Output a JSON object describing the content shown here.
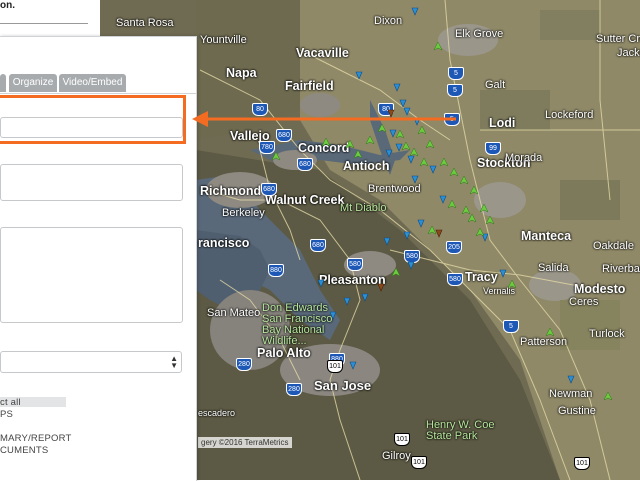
{
  "panel": {
    "top_text": "on.",
    "tabs": [
      {
        "label": ""
      },
      {
        "label": "Organize"
      },
      {
        "label": "Video/Embed"
      }
    ],
    "options": {
      "select_all": "ct all",
      "item_ps": "PS",
      "item_summary": "MARY/REPORT",
      "item_documents": "CUMENTS"
    }
  },
  "map": {
    "attribution": "gery ©2016 TerraMetrics",
    "labels": {
      "santa_rosa": "Santa Rosa",
      "dixon": "Dixon",
      "elk_grove": "Elk Grove",
      "sutter_creek": "Sutter Creek",
      "jackson": "Jackson",
      "yountville": "Yountville",
      "vacaville": "Vacaville",
      "napa": "Napa",
      "fairfield": "Fairfield",
      "galt": "Galt",
      "lodi": "Lodi",
      "lockeford": "Lockeford",
      "vallejo": "Vallejo",
      "concord": "Concord",
      "antioch": "Antioch",
      "brentwood": "Brentwood",
      "stockton": "Stockton",
      "morada": "Morada",
      "richmond": "Richmond",
      "walnut_creek": "Walnut Creek",
      "mt_diablo": "Mt Diablo",
      "berkeley": "Berkeley",
      "francisco": "rancisco",
      "manteca": "Manteca",
      "oakdale": "Oakdale",
      "pleasanton": "Pleasanton",
      "tracy": "Tracy",
      "salida": "Salida",
      "riverbank": "Riverbank",
      "modesto": "Modesto",
      "ceres": "Ceres",
      "don_edwards": "Don Edwards\nSan Francisco\nBay National\nWildlife...",
      "san_mateo": "San Mateo",
      "patterson": "Patterson",
      "turlock": "Turlock",
      "palo_alto": "Palo Alto",
      "san_jose": "San Jose",
      "newman": "Newman",
      "gustine": "Gustine",
      "escadero": "escadero",
      "henry_coe": "Henry W. Coe\nState Park",
      "gilroy": "Gilroy",
      "vernalis": "Vernalis"
    },
    "shields": [
      "80",
      "80",
      "5",
      "5",
      "99",
      "680",
      "780",
      "680",
      "680",
      "680",
      "205",
      "580",
      "580",
      "880",
      "880",
      "580",
      "5",
      "280",
      "280",
      "101",
      "101",
      "101",
      "5",
      "101"
    ]
  },
  "colors": {
    "highlight": "#f36c21",
    "tab_bg": "#a7abae",
    "pin_blue": "#2b8fd6",
    "pin_green": "#6ccb3e",
    "pin_brown": "#8a4a1c"
  }
}
